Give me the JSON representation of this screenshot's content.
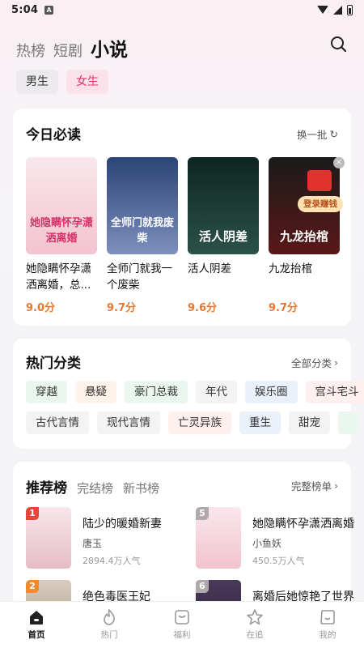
{
  "status_bar": {
    "time": "5:04",
    "notif_letter": "A"
  },
  "top_tabs": [
    {
      "label": "热榜"
    },
    {
      "label": "短剧"
    },
    {
      "label": "小说"
    }
  ],
  "chips": [
    {
      "label": "男生"
    },
    {
      "label": "女生"
    }
  ],
  "must_read": {
    "title": "今日必读",
    "refresh": "换一批",
    "books": [
      {
        "title": "她隐瞒怀孕潇洒离婚，总...",
        "score": "9.0分",
        "cover_text": "她隐瞒怀孕潇洒离婚",
        "cover_bg": "#f7d6df"
      },
      {
        "title": "全师门就我一个废柴",
        "score": "9.7分",
        "cover_text": "全师门就我废柴",
        "cover_bg": "#2b4476"
      },
      {
        "title": "活人阴差",
        "score": "9.6分",
        "cover_text": "活人阴差",
        "cover_bg": "#1d3a33"
      },
      {
        "title": "九龙抬棺",
        "score": "9.7分",
        "cover_text": "九龙抬棺",
        "cover_bg": "#3a1414"
      }
    ],
    "promo": {
      "badge": "登录赚钱"
    }
  },
  "categories": {
    "title": "热门分类",
    "more": "全部分类",
    "row1": [
      {
        "label": "穿越",
        "bg": "#eaf6ee"
      },
      {
        "label": "悬疑",
        "bg": "#fdf3ea"
      },
      {
        "label": "豪门总裁",
        "bg": "#eaf6ee"
      },
      {
        "label": "年代",
        "bg": "#f3f3f3"
      },
      {
        "label": "娱乐圈",
        "bg": "#eaf1fb"
      },
      {
        "label": "宫斗宅斗",
        "bg": "#fdf0ef"
      }
    ],
    "row2": [
      {
        "label": "古代言情",
        "bg": "#f3f3f3"
      },
      {
        "label": "现代言情",
        "bg": "#f3f3f3"
      },
      {
        "label": "亡灵异族",
        "bg": "#fdf0ef"
      },
      {
        "label": "重生",
        "bg": "#eaf1fb"
      },
      {
        "label": "甜宠",
        "bg": "#f3f3f3"
      },
      {
        "label": "",
        "bg": "#eaf6ee"
      }
    ]
  },
  "rankings": {
    "tabs": [
      {
        "label": "推荐榜"
      },
      {
        "label": "完结榜"
      },
      {
        "label": "新书榜"
      }
    ],
    "more": "完整榜单",
    "items": [
      {
        "rank": "1",
        "title": "陆少的暖婚新妻",
        "author": "唐玉",
        "popularity": "2894.4万人气",
        "rank_color": "#e8433b",
        "cover_bg": "#f4dfe3"
      },
      {
        "rank": "5",
        "title": "她隐瞒怀孕潇洒离婚",
        "author": "小鱼妖",
        "popularity": "450.5万人气",
        "rank_color": "#b0a8ad",
        "cover_bg": "#f7d6df"
      },
      {
        "rank": "2",
        "title": "绝色毒医王妃",
        "author": "",
        "popularity": "",
        "rank_color": "#f08a2c",
        "cover_bg": "#c5b8a8"
      },
      {
        "rank": "6",
        "title": "离婚后她惊艳了世界",
        "author": "",
        "popularity": "",
        "rank_color": "#b0a8ad",
        "cover_bg": "#4a3a5a"
      }
    ]
  },
  "bottom_nav": [
    {
      "label": "首页",
      "icon": "home-icon"
    },
    {
      "label": "热门",
      "icon": "flame-icon"
    },
    {
      "label": "福利",
      "icon": "gift-icon"
    },
    {
      "label": "在追",
      "icon": "star-icon"
    },
    {
      "label": "我的",
      "icon": "profile-icon"
    }
  ],
  "colors": {
    "accent": "#e2356b",
    "score": "#e8782f"
  }
}
